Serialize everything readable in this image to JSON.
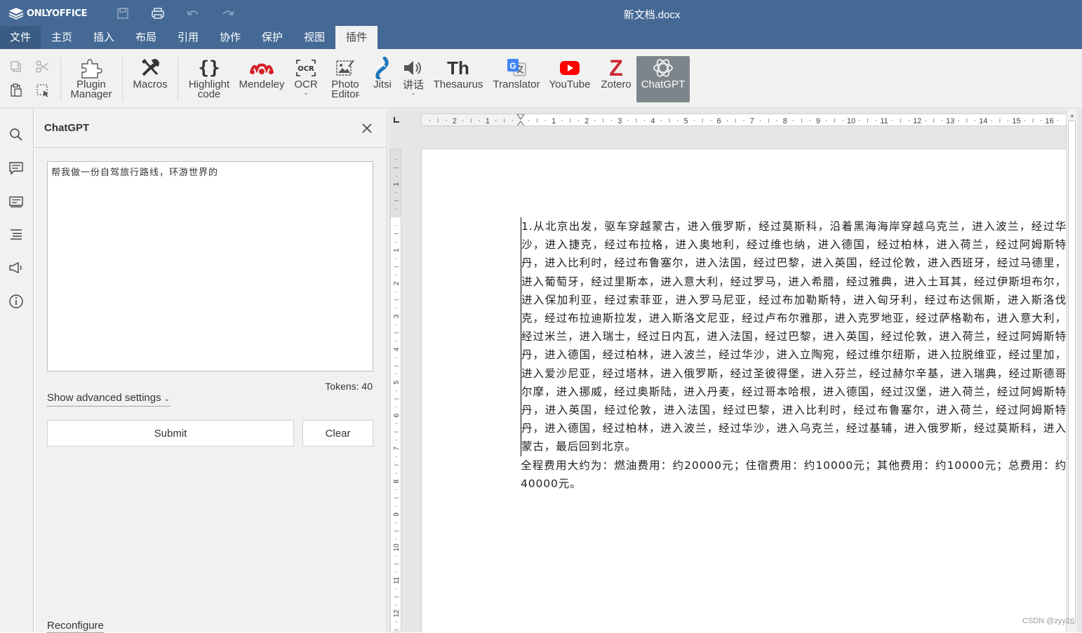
{
  "app": {
    "logo_text": "ONLYOFFICE",
    "doc_title": "新文档.docx"
  },
  "tabs": [
    "文件",
    "主页",
    "插入",
    "布局",
    "引用",
    "协作",
    "保护",
    "视图",
    "插件"
  ],
  "toolbar": {
    "plugin_manager": "Plugin\nManager",
    "macros": "Macros",
    "highlight_code": "Highlight\ncode",
    "mendeley": "Mendeley",
    "ocr": "OCR",
    "photo_editor": "Photo\nEditor",
    "jitsi": "Jitsi",
    "speech": "讲话",
    "thesaurus": "Thesaurus",
    "thesaurus_glyph": "Th",
    "translator": "Translator",
    "youtube": "YouTube",
    "zotero": "Zotero",
    "chatgpt": "ChatGPT"
  },
  "panel": {
    "title": "ChatGPT",
    "prompt_value": "帮我做一份自驾旅行路线，环游世界的",
    "tokens": "Tokens: 40",
    "advanced": "Show advanced settings",
    "submit": "Submit",
    "clear": "Clear",
    "reconfigure": "Reconfigure"
  },
  "document": {
    "paragraphs": [
      "1.从北京出发，驱车穿越蒙古，进入俄罗斯，经过莫斯科，沿着黑海海岸穿越乌克兰，进入波兰，经过华沙，进入捷克，经过布拉格，进入奥地利，经过维也纳，进入德国，经过柏林，进入荷兰，经过阿姆斯特丹，进入比利时，经过布鲁塞尔，进入法国，经过巴黎，进入英国，经过伦敦，进入西班牙，经过马德里，进入葡萄牙，经过里斯本，进入意大利，经过罗马，进入希腊，经过雅典，进入土耳其，经过伊斯坦布尔，进入保加利亚，经过索菲亚，进入罗马尼亚，经过布加勒斯特，进入匈牙利，经过布达佩斯，进入斯洛伐克，经过布拉迪斯拉发，进入斯洛文尼亚，经过卢布尔雅那，进入克罗地亚，经过萨格勒布，进入意大利，经过米兰，进入瑞士，经过日内瓦，进入法国，经过巴黎，进入英国，经过伦敦，进入荷兰，经过阿姆斯特丹，进入德国，经过柏林，进入波兰，经过华沙，进入立陶宛，经过维尔纽斯，进入拉脱维亚，经过里加，进入爱沙尼亚，经过塔林，进入俄罗斯，经过圣彼得堡，进入芬兰，经过赫尔辛基，进入瑞典，经过斯德哥尔摩，进入挪威，经过奥斯陆，进入丹麦，经过哥本哈根，进入德国，经过汉堡，进入荷兰，经过阿姆斯特丹，进入英国，经过伦敦，进入法国，经过巴黎，进入比利时，经过布鲁塞尔，进入荷兰，经过阿姆斯特丹，进入德国，经过柏林，进入波兰，经过华沙，进入乌克兰，经过基辅，进入俄罗斯，经过莫斯科，进入蒙古，最后回到北京。",
      "全程费用大约为：燃油费用：约20000元；住宿费用：约10000元；其他费用：约10000元；总费用：约40000元。"
    ],
    "hruler_marks": [
      "2",
      "1",
      "1",
      "2",
      "3",
      "4",
      "5",
      "6",
      "7",
      "8",
      "9",
      "10",
      "11",
      "12",
      "13",
      "14",
      "15",
      "16"
    ],
    "vruler_marks": [
      "1",
      "1",
      "2",
      "3",
      "4",
      "5",
      "6",
      "7",
      "8",
      "9",
      "10",
      "11",
      "12"
    ]
  },
  "watermark": "CSDN @zyy26",
  "colors": {
    "header": "#446995",
    "toolbar": "#f1f1f1",
    "active_tool": "#7d858c",
    "mendeley": "#d51f26",
    "youtube": "#ff0000",
    "zotero": "#cc2936",
    "translator": "#4285f4",
    "jitsi": "#1d76ba"
  }
}
